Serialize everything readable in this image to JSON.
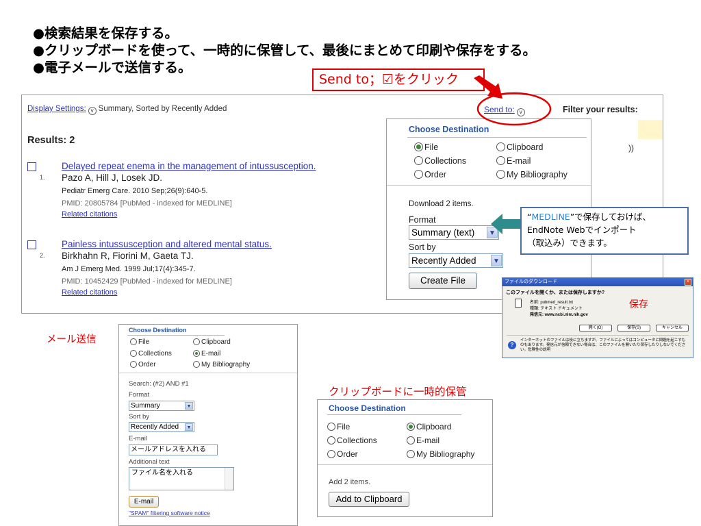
{
  "bullets": [
    "●検索結果を保存する。",
    "●クリップボードを使って、一時的に保管して、最後にまとめて印刷や保存をする。",
    "●電子メールで送信する。"
  ],
  "send_callout": "Send to；☑をクリック",
  "page": {
    "display_settings_link": "Display Settings:",
    "display_settings_value": "Summary, Sorted by Recently Added",
    "results_count": "Results: 2",
    "send_to_link": "Send to:",
    "filter_results": "Filter your results:",
    "side_paren": "))",
    "results": [
      {
        "num": "1.",
        "title": "Delayed repeat enema in the management of intussusception.",
        "authors": "Pazo A, Hill J, Losek JD.",
        "journal": "Pediatr Emerg Care. 2010 Sep;26(9):640-5.",
        "pmid": "PMID: 20805784 [PubMed - indexed for MEDLINE]",
        "related": "Related citations"
      },
      {
        "num": "2.",
        "title": "Painless intussusception and altered mental status.",
        "authors": "Birkhahn R, Fiorini M, Gaeta TJ.",
        "journal": "Am J Emerg Med. 1999 Jul;17(4):345-7.",
        "pmid": "PMID: 10452429 [PubMed - indexed for MEDLINE]",
        "related": "Related citations"
      }
    ]
  },
  "dest_file": {
    "title": "Choose Destination",
    "options": {
      "file": "File",
      "clipboard": "Clipboard",
      "collections": "Collections",
      "email": "E-mail",
      "order": "Order",
      "bibliography": "My Bibliography"
    },
    "selected": "File",
    "download_text": "Download 2 items.",
    "format_label": "Format",
    "format_value": "Summary (text)",
    "sort_label": "Sort by",
    "sort_value": "Recently Added",
    "create_button": "Create File"
  },
  "medline_tip": {
    "quote_open": "“",
    "highlight": "MEDLINE",
    "line1_rest": "”で保存しておけば、",
    "line2": "EndNote Webでインポート",
    "line3": "（取込み）できます。"
  },
  "download_dialog": {
    "title": "ファイルのダウンロード",
    "question": "このファイルを開くか、または保存しますか?",
    "name_row": "名前:   pubmed_result.txt",
    "type_row": "種類:   テキスト ドキュメント",
    "from_row": "発信元:   www.ncbi.nlm.nih.gov",
    "save_label": "保存",
    "open_button": "開く(O)",
    "save_button": "保存(S)",
    "cancel_button": "キャンセル",
    "warning": "インターネットのファイルは役に立ちますが、ファイルによってはコンピュータに問題を起こすものもあります。発信元が信頼できない場合は、このファイルを開いたり保存したりしないでください。危険性の説明"
  },
  "mail_label": "メール送信",
  "dest_mail": {
    "title": "Choose Destination",
    "options": {
      "file": "File",
      "clipboard": "Clipboard",
      "collections": "Collections",
      "email": "E-mail",
      "order": "Order",
      "bibliography": "My Bibliography"
    },
    "selected": "E-mail",
    "search_text": "Search: (#2) AND #1",
    "format_label": "Format",
    "format_value": "Summary",
    "sort_label": "Sort by",
    "sort_value": "Recently Added",
    "email_label": "E-mail",
    "email_value": "メールアドレスを入れる",
    "additional_label": "Additional text",
    "additional_value": "ファイル名を入れる",
    "email_button": "E-mail",
    "spam_notice": "\"SPAM\" filtering software notice"
  },
  "clip_label": "クリップボードに一時的保管",
  "dest_clip": {
    "title": "Choose Destination",
    "options": {
      "file": "File",
      "clipboard": "Clipboard",
      "collections": "Collections",
      "email": "E-mail",
      "order": "Order",
      "bibliography": "My Bibliography"
    },
    "selected": "Clipboard",
    "add_text": "Add 2 items.",
    "add_button": "Add to Clipboard"
  },
  "colors": {
    "accent_red": "#e00000",
    "link_blue": "#2f35b4",
    "dest_title_blue": "#2a57a0",
    "radio_green": "#3a8a3a"
  },
  "icons": [
    "chevron-down-icon",
    "checkbox-icon",
    "radio-icon",
    "red-arrow-icon",
    "left-arrow-icon",
    "file-icon",
    "close-icon",
    "warning-icon"
  ]
}
